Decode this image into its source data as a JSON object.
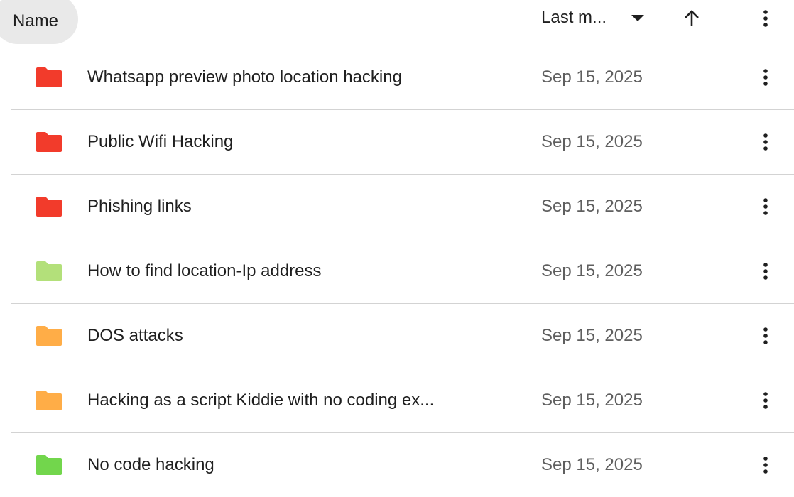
{
  "header": {
    "name_label": "Name",
    "sort_label": "Last m...",
    "dropdown_icon": "caret-down-icon",
    "sort_direction_icon": "arrow-up-icon",
    "more_icon": "more-vert-icon"
  },
  "rows": [
    {
      "name": "Whatsapp preview photo location hacking",
      "date": "Sep 15, 2025",
      "folder_color": "#f23b2b"
    },
    {
      "name": "Public Wifi Hacking",
      "date": "Sep 15, 2025",
      "folder_color": "#f23b2b"
    },
    {
      "name": "Phishing links",
      "date": "Sep 15, 2025",
      "folder_color": "#f23b2b"
    },
    {
      "name": "How to find location-Ip address",
      "date": "Sep 15, 2025",
      "folder_color": "#b3e07a"
    },
    {
      "name": "DOS attacks",
      "date": "Sep 15, 2025",
      "folder_color": "#ffad47"
    },
    {
      "name": "Hacking as a script Kiddie with no coding ex...",
      "date": "Sep 15, 2025",
      "folder_color": "#ffad47"
    },
    {
      "name": "No code hacking",
      "date": "Sep 15, 2025",
      "folder_color": "#72d64c"
    }
  ]
}
